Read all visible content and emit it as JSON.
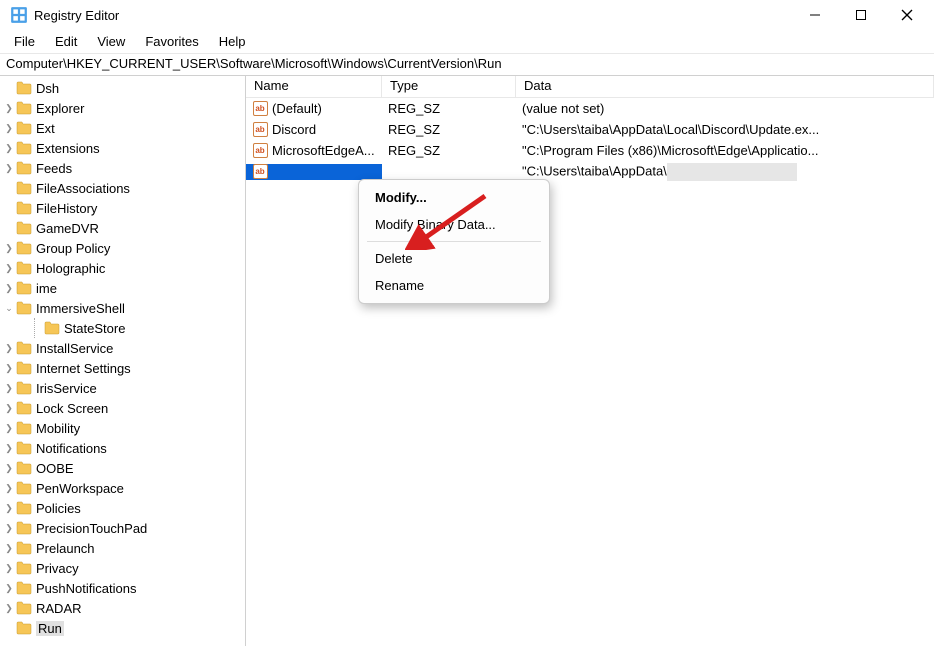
{
  "window": {
    "title": "Registry Editor"
  },
  "menu": {
    "file": "File",
    "edit": "Edit",
    "view": "View",
    "favorites": "Favorites",
    "help": "Help"
  },
  "address": "Computer\\HKEY_CURRENT_USER\\Software\\Microsoft\\Windows\\CurrentVersion\\Run",
  "tree": {
    "items": [
      {
        "label": "Dsh",
        "exp": ""
      },
      {
        "label": "Explorer",
        "exp": ">"
      },
      {
        "label": "Ext",
        "exp": ">"
      },
      {
        "label": "Extensions",
        "exp": ">"
      },
      {
        "label": "Feeds",
        "exp": ">"
      },
      {
        "label": "FileAssociations",
        "exp": ""
      },
      {
        "label": "FileHistory",
        "exp": ""
      },
      {
        "label": "GameDVR",
        "exp": ""
      },
      {
        "label": "Group Policy",
        "exp": ">"
      },
      {
        "label": "Holographic",
        "exp": ">"
      },
      {
        "label": "ime",
        "exp": ">"
      },
      {
        "label": "ImmersiveShell",
        "exp": "v",
        "expanded": true
      },
      {
        "label": "StateStore",
        "exp": "",
        "child": true
      },
      {
        "label": "InstallService",
        "exp": ">"
      },
      {
        "label": "Internet Settings",
        "exp": ">"
      },
      {
        "label": "IrisService",
        "exp": ">"
      },
      {
        "label": "Lock Screen",
        "exp": ">"
      },
      {
        "label": "Mobility",
        "exp": ">"
      },
      {
        "label": "Notifications",
        "exp": ">"
      },
      {
        "label": "OOBE",
        "exp": ">"
      },
      {
        "label": "PenWorkspace",
        "exp": ">"
      },
      {
        "label": "Policies",
        "exp": ">"
      },
      {
        "label": "PrecisionTouchPad",
        "exp": ">"
      },
      {
        "label": "Prelaunch",
        "exp": ">"
      },
      {
        "label": "Privacy",
        "exp": ">"
      },
      {
        "label": "PushNotifications",
        "exp": ">"
      },
      {
        "label": "RADAR",
        "exp": ">"
      },
      {
        "label": "Run",
        "exp": "",
        "selected": true
      }
    ]
  },
  "list": {
    "headers": {
      "name": "Name",
      "type": "Type",
      "data": "Data"
    },
    "rows": [
      {
        "name": "(Default)",
        "type": "REG_SZ",
        "data": "(value not set)"
      },
      {
        "name": "Discord",
        "type": "REG_SZ",
        "data": "\"C:\\Users\\taiba\\AppData\\Local\\Discord\\Update.ex..."
      },
      {
        "name": "MicrosoftEdgeA...",
        "type": "REG_SZ",
        "data": "\"C:\\Program Files (x86)\\Microsoft\\Edge\\Applicatio..."
      },
      {
        "name": "",
        "type": "",
        "data": "\"C:\\Users\\taiba\\AppData\\",
        "selected": true,
        "redact": true
      }
    ]
  },
  "context_menu": {
    "modify": "Modify...",
    "modify_binary": "Modify Binary Data...",
    "delete": "Delete",
    "rename": "Rename"
  }
}
